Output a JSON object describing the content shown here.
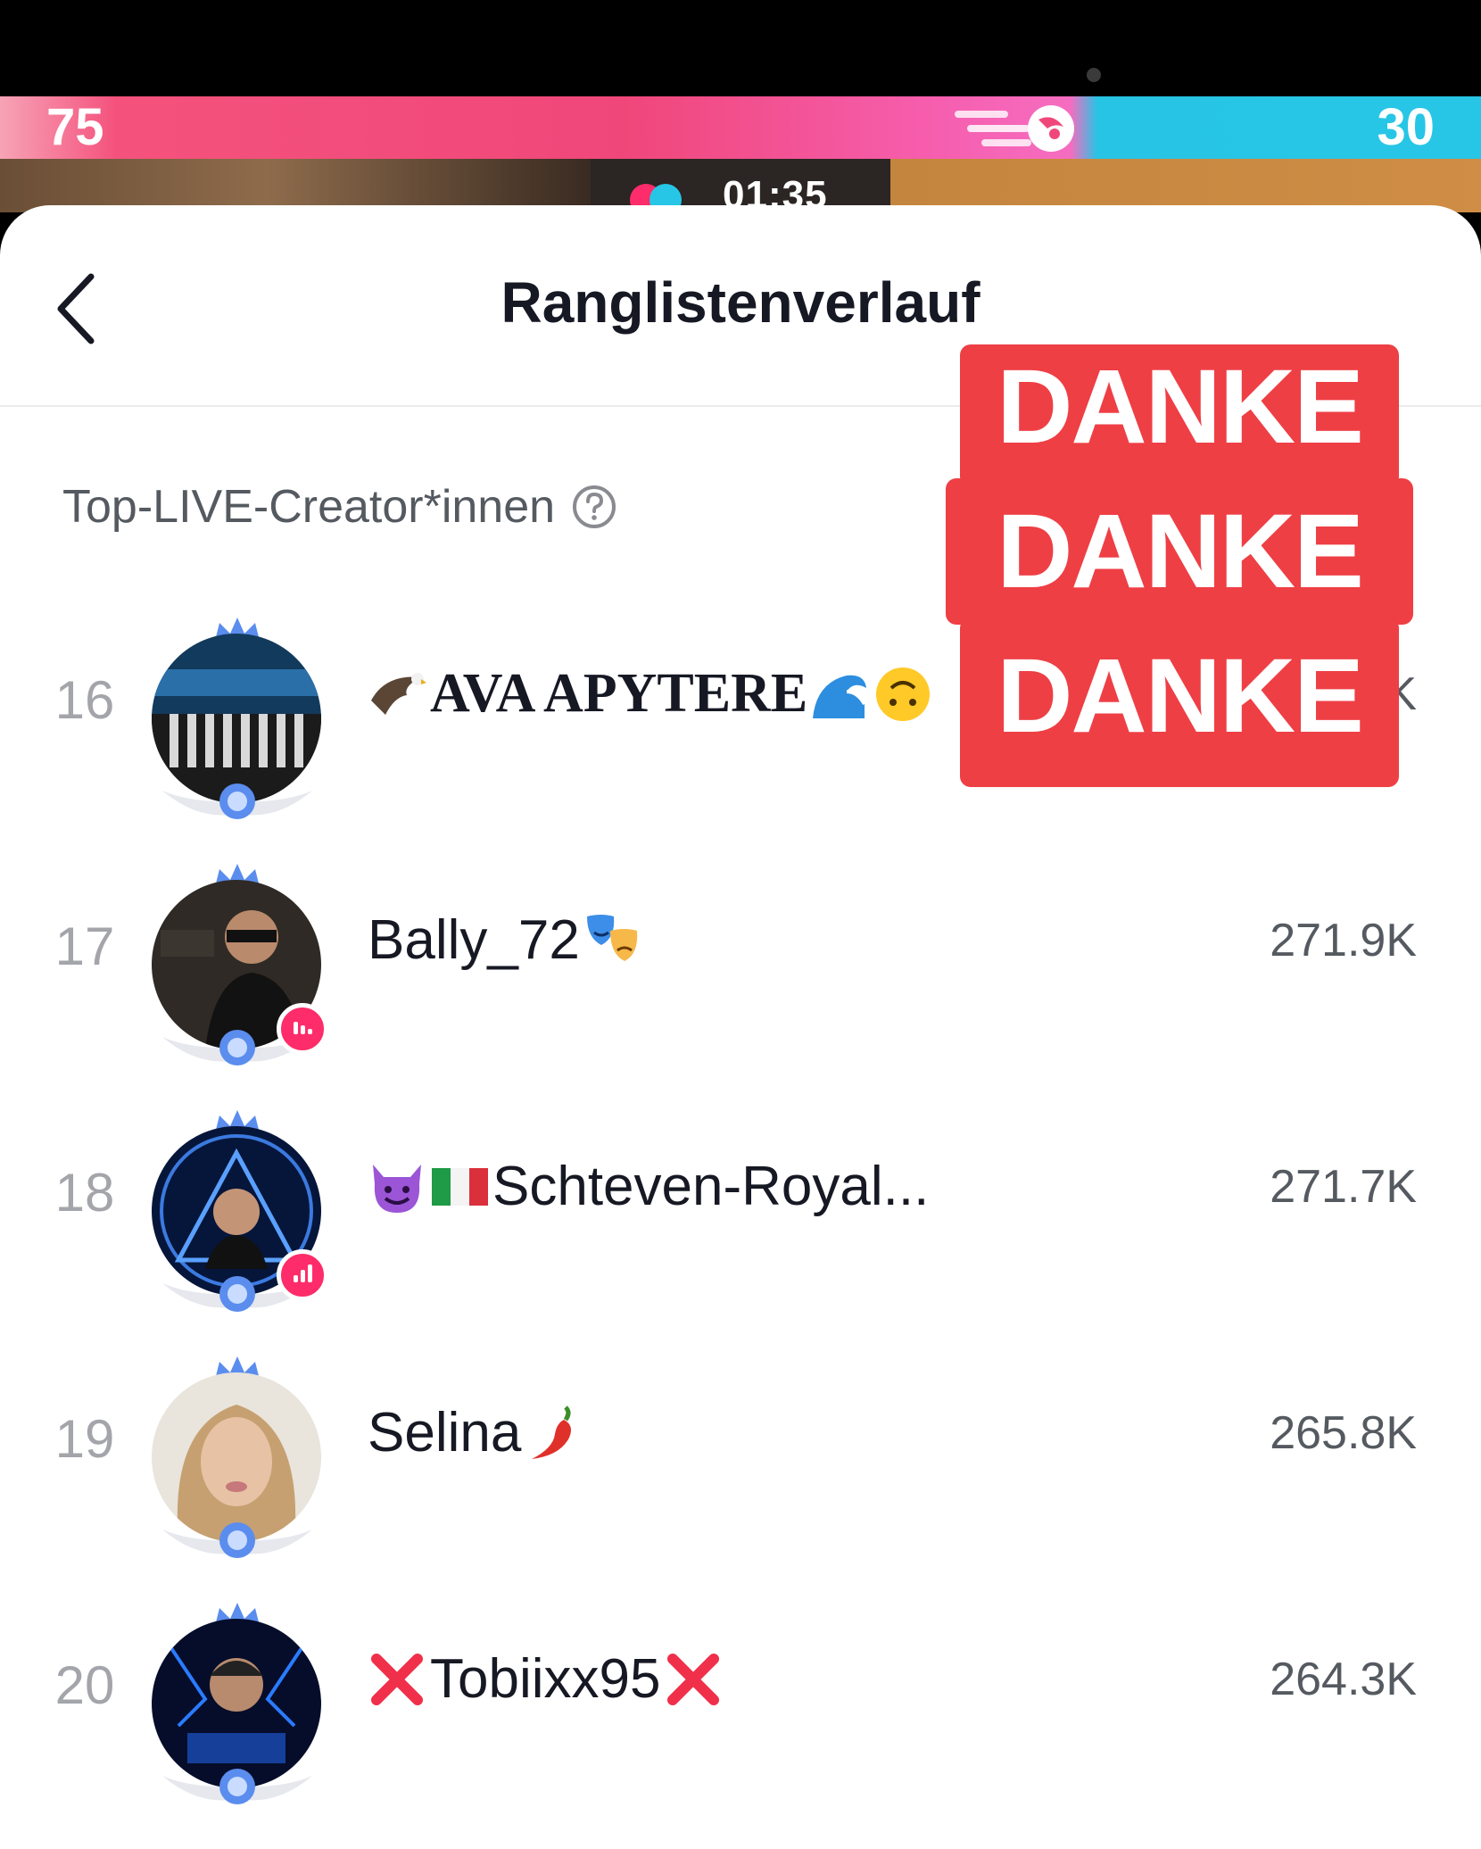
{
  "battle": {
    "left_score": "75",
    "right_score": "30",
    "timer": "01:35",
    "left_color": "#f0477a",
    "right_color": "#27c6e6"
  },
  "header": {
    "back_icon": "chevron-left-icon",
    "title": "Ranglistenverlauf"
  },
  "section": {
    "label": "Top-LIVE-Creator*innen",
    "help_icon": "question-circle-icon"
  },
  "ranking": [
    {
      "rank": "16",
      "name": "AVA APYTERE",
      "prefix_icon": "eagle-emoji",
      "suffix_icons": [
        "wave-emoji",
        "upside-down-face-emoji"
      ],
      "score": "",
      "live": false
    },
    {
      "rank": "17",
      "name": "Bally_72",
      "prefix_icon": "",
      "suffix_icons": [
        "performing-arts-emoji"
      ],
      "score": "271.9K",
      "live": true
    },
    {
      "rank": "18",
      "name": "Schteven-Royal...",
      "prefix_icon": "smiling-devil-emoji italy-flag-emoji",
      "suffix_icons": [],
      "score": "271.7K",
      "live": true
    },
    {
      "rank": "19",
      "name": "Selina",
      "prefix_icon": "",
      "suffix_icons": [
        "chili-pepper-emoji"
      ],
      "score": "265.8K",
      "live": false
    },
    {
      "rank": "20",
      "name": "Tobiixx95",
      "prefix_icon": "cross-mark-emoji",
      "suffix_icons": [
        "cross-mark-emoji"
      ],
      "score": "264.3K",
      "live": false
    }
  ],
  "overlay": {
    "line1": "DANKE",
    "line2": "DANKE",
    "line3": "DANKE",
    "color": "#ee3f45",
    "partial_score_char": "K"
  }
}
